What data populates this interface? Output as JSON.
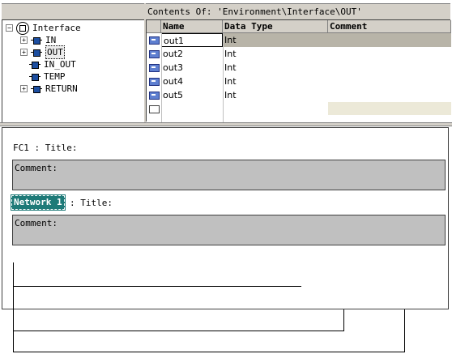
{
  "contents_title": "Contents Of: 'Environment\\Interface\\OUT'",
  "tree": {
    "root": "Interface",
    "items": [
      {
        "label": "IN",
        "expandable": true,
        "selected": false
      },
      {
        "label": "OUT",
        "expandable": true,
        "selected": true
      },
      {
        "label": "IN_OUT",
        "expandable": false,
        "selected": false
      },
      {
        "label": "TEMP",
        "expandable": false,
        "selected": false
      },
      {
        "label": "RETURN",
        "expandable": true,
        "selected": false
      }
    ]
  },
  "table": {
    "headers": {
      "name": "Name",
      "type": "Data Type",
      "comment": "Comment"
    },
    "rows": [
      {
        "name": "out1",
        "type": "Int",
        "comment": ""
      },
      {
        "name": "out2",
        "type": "Int",
        "comment": ""
      },
      {
        "name": "out3",
        "type": "Int",
        "comment": ""
      },
      {
        "name": "out4",
        "type": "Int",
        "comment": ""
      },
      {
        "name": "out5",
        "type": "Int",
        "comment": ""
      }
    ],
    "selected_row": 0
  },
  "block": {
    "title": "FC1 : Title:",
    "comment_label": "Comment:"
  },
  "network": {
    "label": "Network 1",
    "title": ": Title:",
    "comment_label": "Comment:"
  },
  "colors": {
    "panel": "#d4d0c8",
    "comment_bg": "#c0c0c0",
    "network_bg": "#1e7a78",
    "selected_row": "#b8b4a8"
  }
}
